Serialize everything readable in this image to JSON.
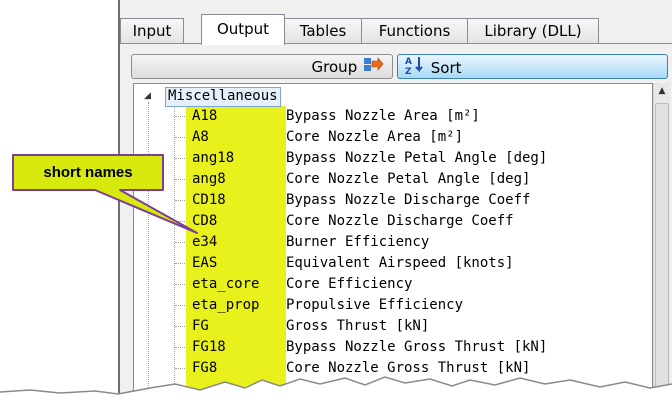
{
  "tabs": [
    {
      "label": "Input",
      "active": false
    },
    {
      "label": "Output",
      "active": true
    },
    {
      "label": "Tables",
      "active": false
    },
    {
      "label": "Functions",
      "active": false
    },
    {
      "label": "Library (DLL)",
      "active": false
    }
  ],
  "toolbar": {
    "group_label": "Group",
    "group_icon": "group-arrow-icon",
    "sort_label": "Sort",
    "sort_icon": "sort-az-icon",
    "sort_icon_letters": "AZ"
  },
  "tree": {
    "root_label": "Miscellaneous",
    "highlight_color": "#e8f11b",
    "items": [
      {
        "name": "A18",
        "desc": "Bypass Nozzle Area [m²]"
      },
      {
        "name": "A8",
        "desc": "Core Nozzle Area [m²]"
      },
      {
        "name": "ang18",
        "desc": "Bypass Nozzle Petal Angle [deg]"
      },
      {
        "name": "ang8",
        "desc": "Core Nozzle Petal Angle [deg]"
      },
      {
        "name": "CD18",
        "desc": "Bypass Nozzle Discharge Coeff"
      },
      {
        "name": "CD8",
        "desc": "Core Nozzle Discharge Coeff"
      },
      {
        "name": "e34",
        "desc": "Burner Efficiency"
      },
      {
        "name": "EAS",
        "desc": "Equivalent Airspeed [knots]"
      },
      {
        "name": "eta_core",
        "desc": "Core Efficiency"
      },
      {
        "name": "eta_prop",
        "desc": "Propulsive Efficiency"
      },
      {
        "name": "FG",
        "desc": "Gross Thrust [kN]"
      },
      {
        "name": "FG18",
        "desc": "Bypass Nozzle Gross Thrust [kN]"
      },
      {
        "name": "FG8",
        "desc": "Core Nozzle Gross Thrust [kN]"
      }
    ]
  },
  "callout": {
    "text": "short names",
    "fill_color": "#d8ea0d",
    "border_color": "#7b3f9a"
  }
}
